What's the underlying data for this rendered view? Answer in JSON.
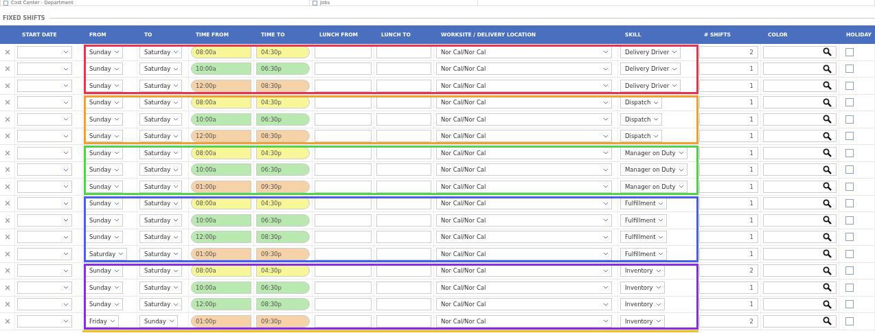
{
  "filters": [
    {
      "label": "Cost Center - Department",
      "checked": false
    },
    {
      "label": "Jobs",
      "checked": false
    }
  ],
  "section_title": "FIXED SHIFTS",
  "columns": [
    "START DATE",
    "FROM",
    "TO",
    "TIME FROM",
    "TIME TO",
    "LUNCH FROM",
    "LUNCH TO",
    "WORKSITE / DELIVERY LOCATION",
    "SKILL",
    "# SHIFTS",
    "COLOR",
    "HOLIDAY"
  ],
  "groups": [
    {
      "color": "#e8334f",
      "rows": [
        {
          "from": "Sunday",
          "to": "Saturday",
          "time_from": "08:00a",
          "time_to": "04:30p",
          "color": "#f7f79a",
          "location": "Nor Cal/Nor Cal",
          "skill": "Delivery Driver",
          "shifts": "2",
          "holiday": false
        },
        {
          "from": "Sunday",
          "to": "Saturday",
          "time_from": "10:00a",
          "time_to": "06:30p",
          "color": "#b9e9b0",
          "location": "Nor Cal/Nor Cal",
          "skill": "Delivery Driver",
          "shifts": "1",
          "holiday": false
        },
        {
          "from": "Sunday",
          "to": "Saturday",
          "time_from": "12:00p",
          "time_to": "08:30p",
          "color": "#f5d2a8",
          "location": "Nor Cal/Nor Cal",
          "skill": "Delivery Driver",
          "shifts": "1",
          "holiday": false
        }
      ]
    },
    {
      "color": "#f0a030",
      "rows": [
        {
          "from": "Sunday",
          "to": "Saturday",
          "time_from": "08:00a",
          "time_to": "04:30p",
          "color": "#f7f79a",
          "location": "Nor Cal/Nor Cal",
          "skill": "Dispatch",
          "shifts": "1",
          "holiday": false
        },
        {
          "from": "Sunday",
          "to": "Saturday",
          "time_from": "10:00a",
          "time_to": "06:30p",
          "color": "#b9e9b0",
          "location": "Nor Cal/Nor Cal",
          "skill": "Dispatch",
          "shifts": "1",
          "holiday": false
        },
        {
          "from": "Sunday",
          "to": "Saturday",
          "time_from": "12:00p",
          "time_to": "08:30p",
          "color": "#f5d2a8",
          "location": "Nor Cal/Nor Cal",
          "skill": "Dispatch",
          "shifts": "1",
          "holiday": false
        }
      ]
    },
    {
      "color": "#4ed34a",
      "rows": [
        {
          "from": "Sunday",
          "to": "Saturday",
          "time_from": "08:00a",
          "time_to": "04:30p",
          "color": "#f7f79a",
          "location": "Nor Cal/Nor Cal",
          "skill": "Manager on Duty",
          "shifts": "1",
          "holiday": false
        },
        {
          "from": "Sunday",
          "to": "Saturday",
          "time_from": "10:00a",
          "time_to": "06:30p",
          "color": "#b9e9b0",
          "location": "Nor Cal/Nor Cal",
          "skill": "Manager on Duty",
          "shifts": "1",
          "holiday": false
        },
        {
          "from": "Sunday",
          "to": "Saturday",
          "time_from": "01:00p",
          "time_to": "09:30p",
          "color": "#f5d2a8",
          "location": "Nor Cal/Nor Cal",
          "skill": "Manager on Duty",
          "shifts": "1",
          "holiday": false
        }
      ]
    },
    {
      "color": "#4a5cf0",
      "rows": [
        {
          "from": "Sunday",
          "to": "Saturday",
          "time_from": "08:00a",
          "time_to": "04:30p",
          "color": "#f7f79a",
          "location": "Nor Cal/Nor Cal",
          "skill": "Fulfillment",
          "shifts": "1",
          "holiday": false
        },
        {
          "from": "Sunday",
          "to": "Saturday",
          "time_from": "10:00a",
          "time_to": "06:30p",
          "color": "#b9e9b0",
          "location": "Nor Cal/Nor Cal",
          "skill": "Fulfillment",
          "shifts": "1",
          "holiday": false
        },
        {
          "from": "Sunday",
          "to": "Saturday",
          "time_from": "12:00p",
          "time_to": "08:30p",
          "color": "#b9e9b0",
          "location": "Nor Cal/Nor Cal",
          "skill": "Fulfillment",
          "shifts": "1",
          "holiday": false
        },
        {
          "from": "Saturday",
          "to": "Saturday",
          "time_from": "01:00p",
          "time_to": "09:30p",
          "color": "#f5d2a8",
          "location": "Nor Cal/Nor Cal",
          "skill": "Fulfillment",
          "shifts": "1",
          "holiday": false
        }
      ]
    },
    {
      "color": "#8a2be2",
      "rows": [
        {
          "from": "Sunday",
          "to": "Saturday",
          "time_from": "08:00a",
          "time_to": "04:30p",
          "color": "#f7f79a",
          "location": "Nor Cal/Nor Cal",
          "skill": "Inventory",
          "shifts": "2",
          "holiday": false
        },
        {
          "from": "Sunday",
          "to": "Saturday",
          "time_from": "10:00a",
          "time_to": "06:30p",
          "color": "#b9e9b0",
          "location": "Nor Cal/Nor Cal",
          "skill": "Inventory",
          "shifts": "1",
          "holiday": false
        },
        {
          "from": "Sunday",
          "to": "Saturday",
          "time_from": "12:00p",
          "time_to": "08:30p",
          "color": "#b9e9b0",
          "location": "Nor Cal/Nor Cal",
          "skill": "Inventory",
          "shifts": "1",
          "holiday": false
        },
        {
          "from": "Friday",
          "to": "Sunday",
          "time_from": "01:00p",
          "time_to": "09:30p",
          "color": "#f5d2a8",
          "location": "Nor Cal/Nor Cal",
          "skill": "Inventory",
          "shifts": "2",
          "holiday": false
        }
      ]
    }
  ],
  "next_group": {
    "color": "#f0c020"
  }
}
